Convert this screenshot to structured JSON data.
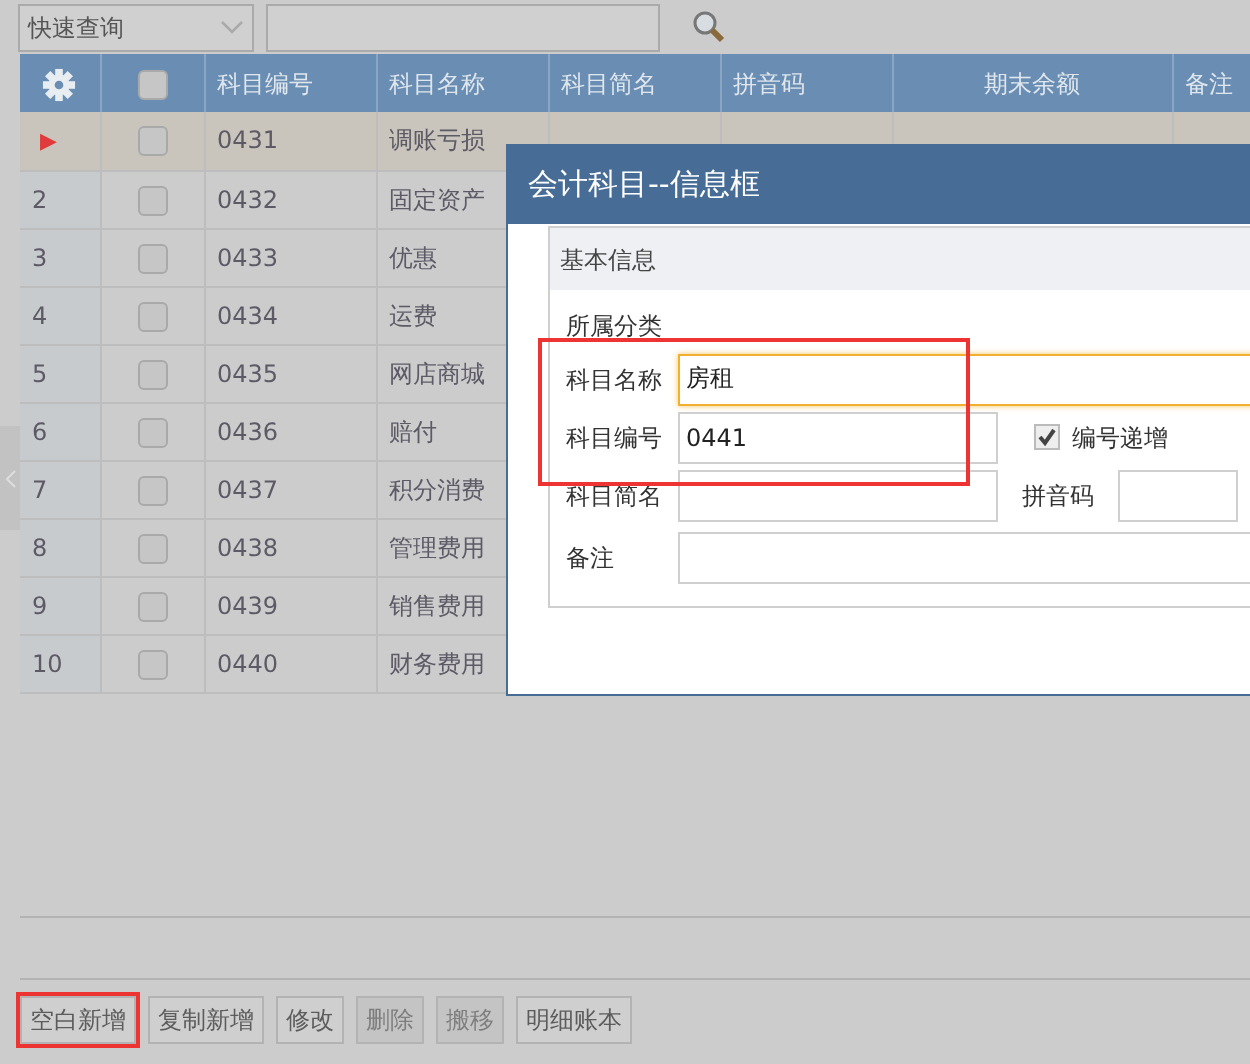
{
  "toolbar": {
    "query_select": "快速查询"
  },
  "table": {
    "select_all_checked": false,
    "columns": [
      "科目编号",
      "科目名称",
      "科目简名",
      "拼音码",
      "期末余额",
      "备注"
    ],
    "rows": [
      {
        "index": "▶",
        "kind": "current",
        "selected": true,
        "checked": false,
        "code": "0431",
        "name": "调账亏损"
      },
      {
        "index": "2",
        "kind": "number",
        "selected": false,
        "checked": false,
        "code": "0432",
        "name": "固定资产"
      },
      {
        "index": "3",
        "kind": "number",
        "selected": false,
        "checked": false,
        "code": "0433",
        "name": "优惠"
      },
      {
        "index": "4",
        "kind": "number",
        "selected": false,
        "checked": false,
        "code": "0434",
        "name": "运费"
      },
      {
        "index": "5",
        "kind": "number",
        "selected": false,
        "checked": false,
        "code": "0435",
        "name": "网店商城"
      },
      {
        "index": "6",
        "kind": "number",
        "selected": false,
        "checked": false,
        "code": "0436",
        "name": "赔付"
      },
      {
        "index": "7",
        "kind": "number",
        "selected": false,
        "checked": false,
        "code": "0437",
        "name": "积分消费"
      },
      {
        "index": "8",
        "kind": "number",
        "selected": false,
        "checked": false,
        "code": "0438",
        "name": "管理费用"
      },
      {
        "index": "9",
        "kind": "number",
        "selected": false,
        "checked": false,
        "code": "0439",
        "name": "销售费用"
      },
      {
        "index": "10",
        "kind": "number",
        "selected": false,
        "checked": false,
        "code": "0440",
        "name": "财务费用"
      }
    ]
  },
  "buttons": [
    {
      "label": "空白新增",
      "disabled": false,
      "highlighted": true
    },
    {
      "label": "复制新增",
      "disabled": false,
      "highlighted": false
    },
    {
      "label": "修改",
      "disabled": false,
      "highlighted": false
    },
    {
      "label": "删除",
      "disabled": true,
      "highlighted": false
    },
    {
      "label": "搬移",
      "disabled": true,
      "highlighted": false
    },
    {
      "label": "明细账本",
      "disabled": false,
      "highlighted": false
    }
  ],
  "dialog": {
    "title": "会计科目--信息框",
    "section": "基本信息",
    "category_label": "所属分类",
    "fields": [
      {
        "label": "科目名称",
        "value": "房租",
        "focused": true
      },
      {
        "label": "科目编号",
        "value": "0441",
        "focused": false
      },
      {
        "label": "科目简名",
        "focused": false
      },
      {
        "label": "备注",
        "focused": false
      }
    ],
    "auto_increment": {
      "label": "编号递增",
      "checked": true
    },
    "pinyin_label": "拼音码"
  }
}
